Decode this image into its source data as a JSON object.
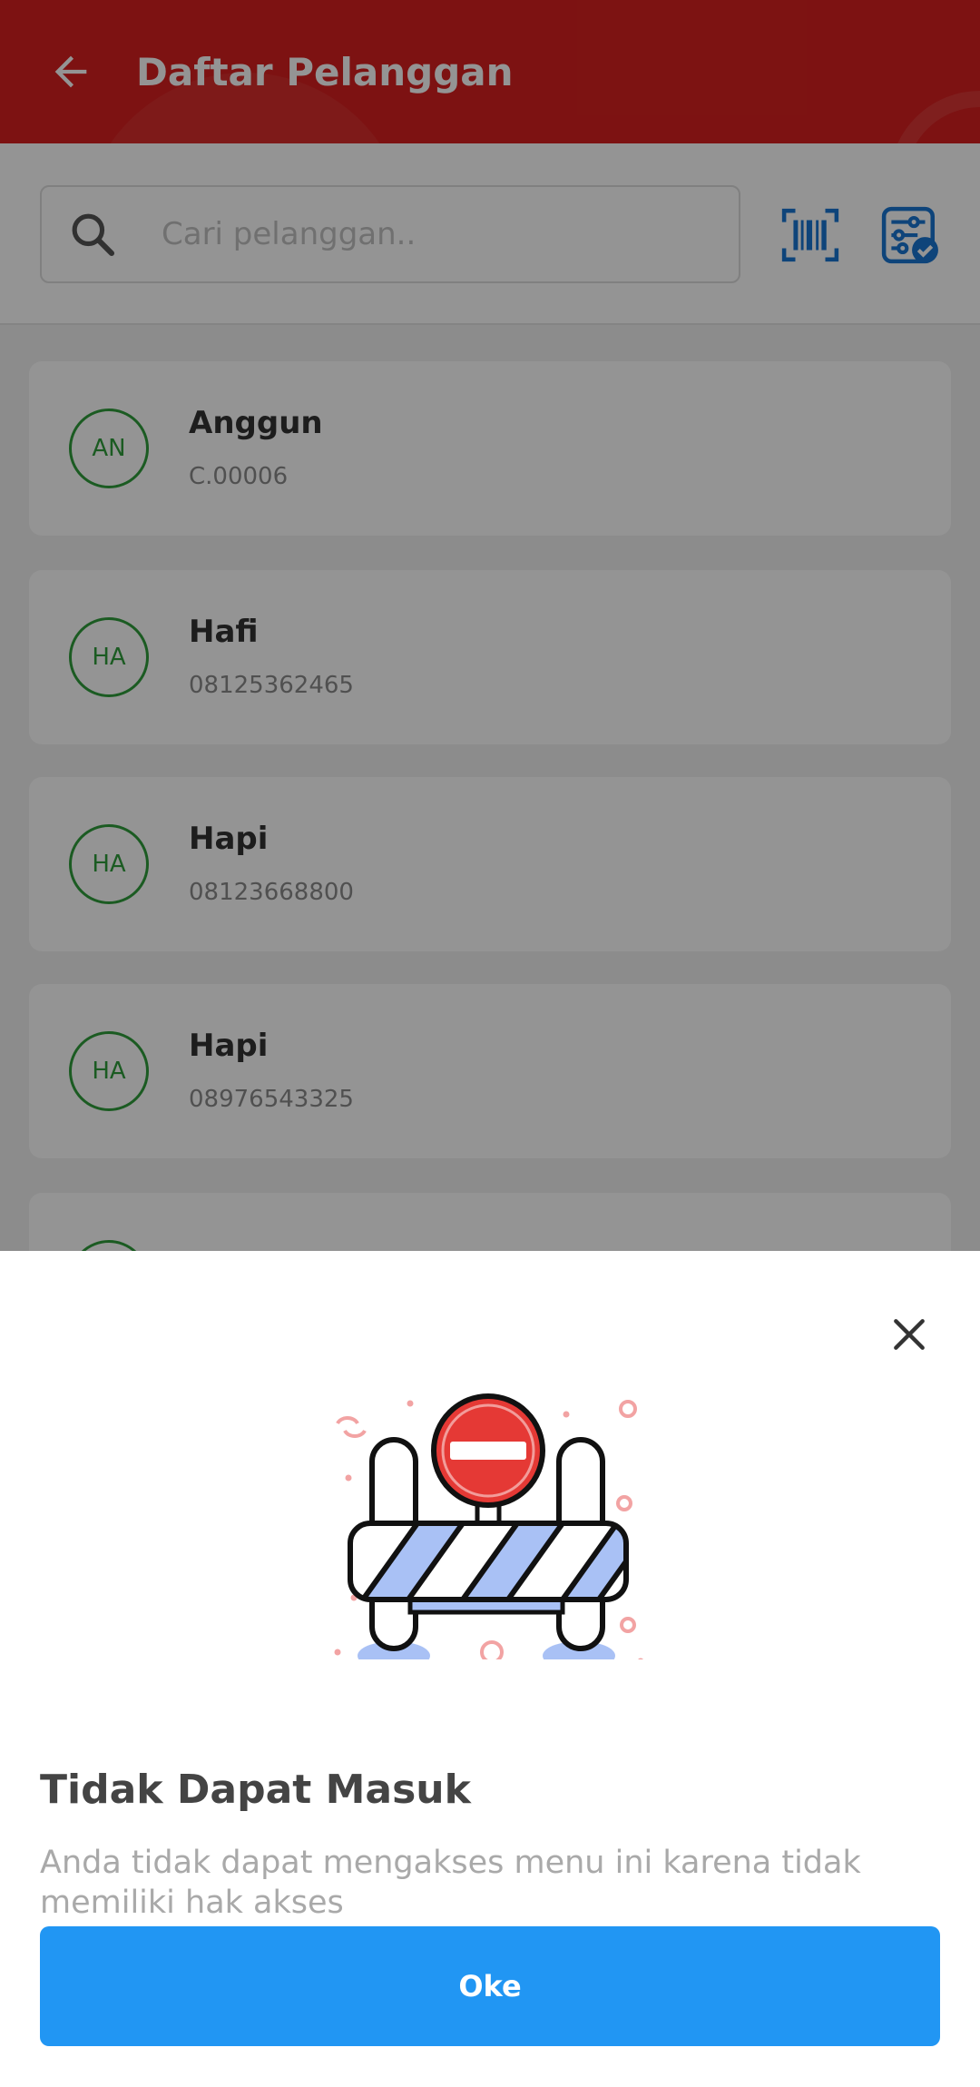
{
  "appbar": {
    "title": "Daftar Pelanggan",
    "back_icon": "arrow-left-icon",
    "color": "#d7201f"
  },
  "search": {
    "placeholder": "Cari pelanggan..",
    "search_icon": "search-icon",
    "barcode_icon": "barcode-scan-icon",
    "filter_icon": "filter-settings-icon",
    "icon_color": "#1976d2"
  },
  "customers": [
    {
      "initials": "AN",
      "name": "Anggun",
      "sub": "C.00006"
    },
    {
      "initials": "HA",
      "name": "Hafi",
      "sub": "08125362465"
    },
    {
      "initials": "HA",
      "name": "Hapi",
      "sub": "08123668800"
    },
    {
      "initials": "HA",
      "name": "Hapi",
      "sub": "08976543325"
    }
  ],
  "dialog": {
    "close_icon": "close-icon",
    "illustration": "road-barrier-no-entry-icon",
    "title": "Tidak Dapat Masuk",
    "message": "Anda tidak dapat mengakses menu ini karena tidak memiliki hak akses",
    "ok_label": "Oke",
    "button_color": "#2196f3"
  }
}
